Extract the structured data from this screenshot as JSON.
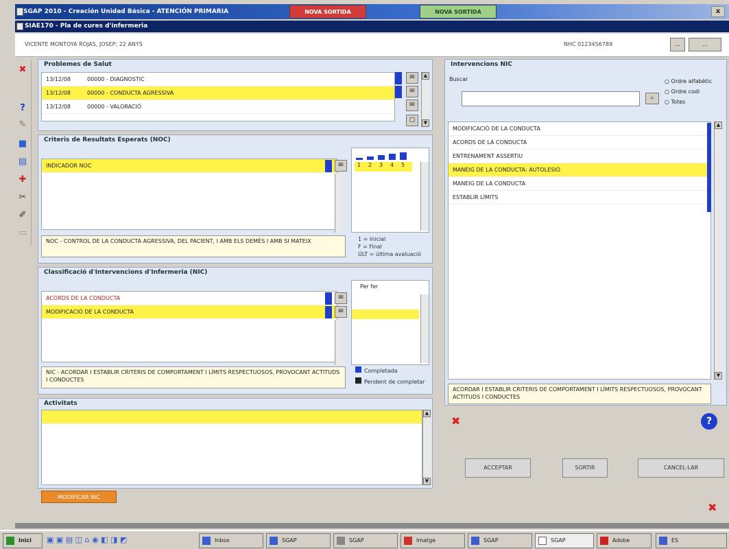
{
  "window": {
    "title": "SGAP 2010 - Creación Unidad Básica - ATENCIÓN PRIMARIA",
    "red_button": "NOVA SORTIDA",
    "green_button": "NOVA SORTIDA",
    "close_label": "x",
    "subtitle": "SIAE170 - Pla de cures d'infermeria"
  },
  "patient": {
    "name": "VICENTE MONTOYA ROJAS, JOSEP; 22 ANYS",
    "id_label": "NHC 0123456789",
    "btn1": "...",
    "btn2": "..."
  },
  "problems": {
    "title": "Problemes de Salut",
    "rows": [
      {
        "code": "13/12/08",
        "text": "00000 - DIAGNOSTIC"
      },
      {
        "code": "13/12/08",
        "text": "00000 - CONDUCTA AGRESSIVA"
      },
      {
        "code": "13/12/08",
        "text": "00000 - VALORACIÓ"
      }
    ]
  },
  "criteria": {
    "title": "Criteris de Resultats Esperats (NOC)",
    "rows": [
      "INDICADOR NOC"
    ],
    "desc": "NOC - CONTROL DE LA CONDUCTA AGRESSIVA, DEL PACIENT, I AMB ELS DEMÉS I AMB SI MATEIX",
    "scale": [
      "1",
      "2",
      "3",
      "4",
      "5"
    ],
    "legend1": "1 = Inicial",
    "legend2": "F = Final",
    "legend3": "ÚLT = última avaluació"
  },
  "interventions": {
    "title": "Classificació d'Intervencions d'Infermeria (NIC)",
    "rows": [
      "ACORDS DE LA CONDUCTA",
      "MODIFICACIÓ DE LA CONDUCTA"
    ],
    "desc": "NIC - ACORDAR I ESTABLIR CRITERIS DE COMPORTAMENT I LÍMITS RESPECTUOSOS, PROVOCANT ACTITUDS I CONDUCTES",
    "side_header": "Per fer",
    "legend1": "Completada",
    "legend2": "Pendent de completar"
  },
  "activities": {
    "title": "Activitats",
    "footer_button": "MODIFICAR NIC"
  },
  "right": {
    "title": "Intervencions NIC",
    "search_label": "Buscar",
    "search_value": "",
    "radio1": "Ordre alfabètic",
    "radio2": "Ordre codi",
    "radio3": "Totes",
    "list": [
      "MODIFICACIÓ DE LA CONDUCTA",
      "ACORDS DE LA CONDUCTA",
      "ENTRENAMENT ASSERTIU",
      "MANEIG DE LA CONDUCTA: AUTOLESIÓ",
      "MANEIG DE LA CONDUCTA",
      "ESTABLIR LÍMITS"
    ],
    "desc": "ACORDAR I ESTABLIR CRITERIS DE COMPORTAMENT I LÍMITS RESPECTUOSOS, PROVOCANT ACTITUDS I CONDUCTES",
    "btn_a": "ACCEPTAR",
    "btn_b": "SORTIR",
    "btn_c": "CANCEL·LAR"
  },
  "taskbar": {
    "start": "Inici",
    "tasks": [
      "Inbox",
      "SGAP",
      "SGAP",
      "Imatge",
      "SGAP",
      "SGAP",
      "Adobe",
      "ES"
    ]
  },
  "colors": {
    "selection": "#fff34a",
    "accent": "#1e3ecb",
    "orange": "#e8892a"
  }
}
